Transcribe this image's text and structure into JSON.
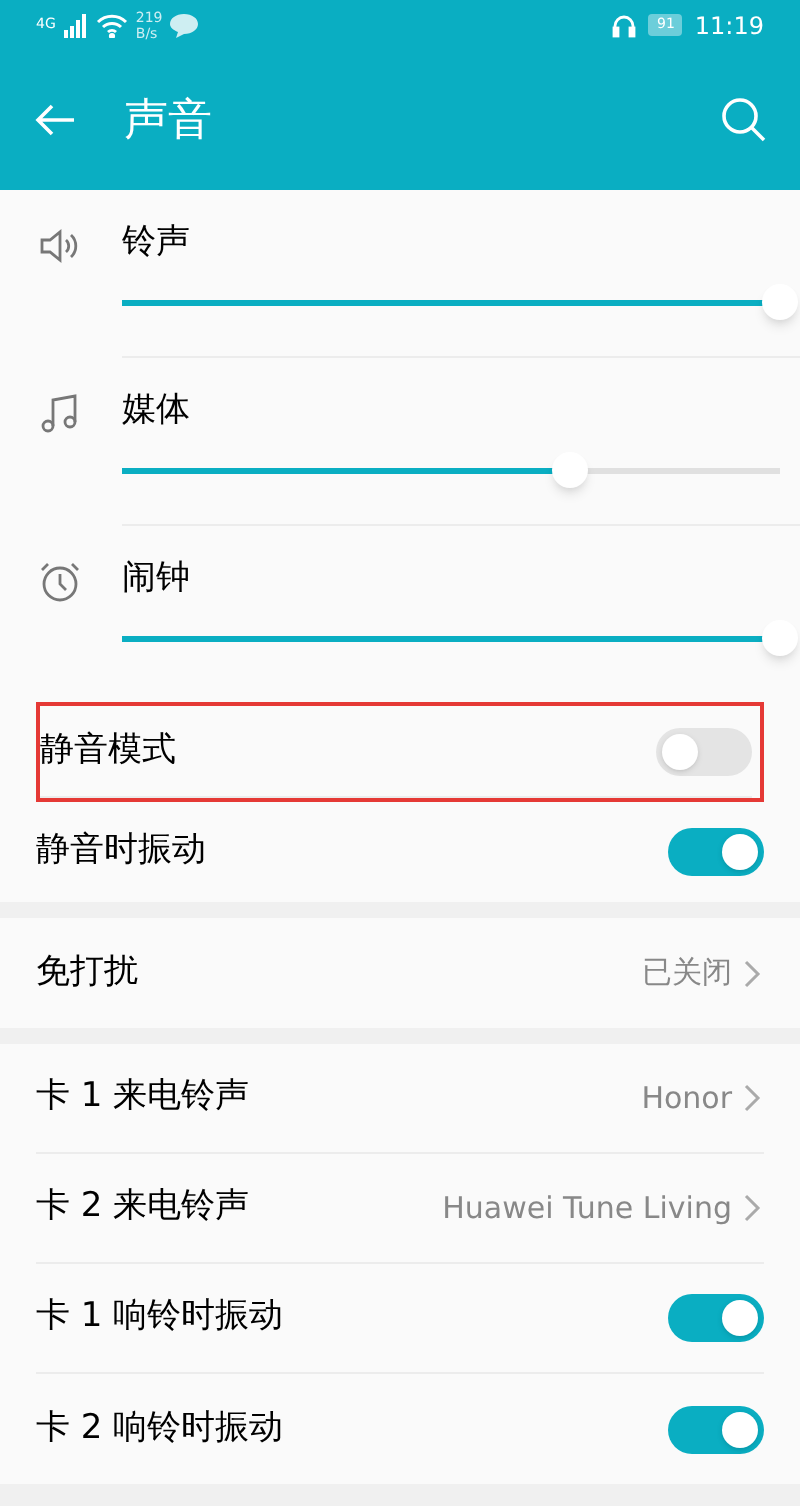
{
  "status_bar": {
    "network": "4G",
    "speed": "219",
    "speed_unit": "B/s",
    "battery": "91",
    "time": "11:19"
  },
  "header": {
    "title": "声音"
  },
  "volumes": [
    {
      "kind": "speaker",
      "label": "铃声",
      "level": 1
    },
    {
      "kind": "music",
      "label": "媒体",
      "level": 0.68
    },
    {
      "kind": "alarm",
      "label": "闹钟",
      "level": 1
    }
  ],
  "groups": [
    [
      {
        "kind": "toggle",
        "label": "静音模式",
        "on": false,
        "highlighted": true
      },
      {
        "kind": "toggle",
        "label": "静音时振动",
        "on": true,
        "highlighted": false
      }
    ],
    [
      {
        "kind": "link",
        "label": "免打扰",
        "value": "已关闭"
      }
    ],
    [
      {
        "kind": "link",
        "label": "卡 1 来电铃声",
        "value": "Honor"
      },
      {
        "kind": "link",
        "label": "卡 2 来电铃声",
        "value": "Huawei Tune Living"
      },
      {
        "kind": "toggle",
        "label": "卡 1 响铃时振动",
        "on": true,
        "highlighted": false
      },
      {
        "kind": "toggle",
        "label": "卡 2 响铃时振动",
        "on": true,
        "highlighted": false
      }
    ]
  ]
}
